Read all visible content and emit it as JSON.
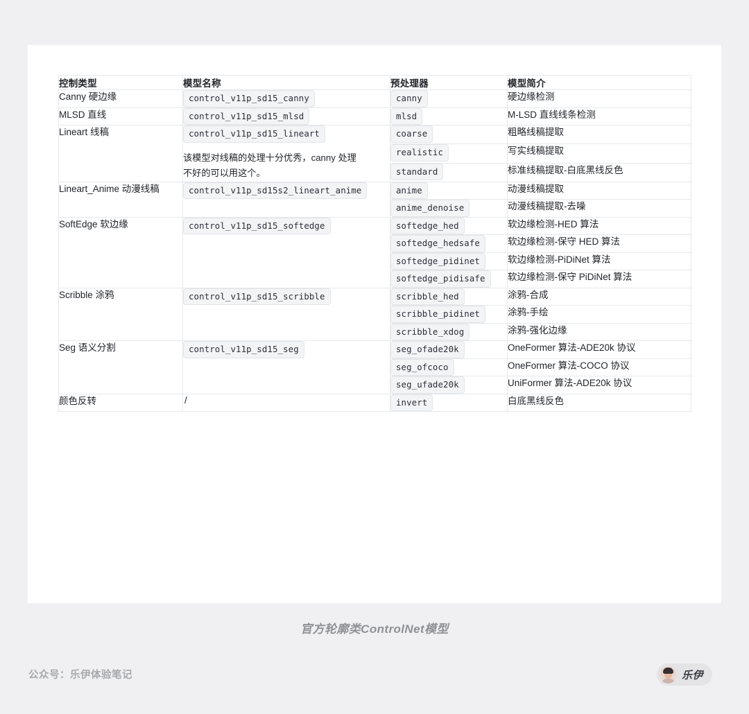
{
  "table": {
    "headers": [
      "控制类型",
      "模型名称",
      "预处理器",
      "模型简介"
    ],
    "groups": [
      {
        "type": "Canny 硬边缘",
        "model": "control_v11p_sd15_canny",
        "note": "",
        "rows": [
          {
            "preprocessor": "canny",
            "desc": "硬边缘检测"
          }
        ]
      },
      {
        "type": "MLSD 直线",
        "model": "control_v11p_sd15_mlsd",
        "note": "",
        "rows": [
          {
            "preprocessor": "mlsd",
            "desc": "M-LSD 直线线条检测"
          }
        ]
      },
      {
        "type": "Lineart 线稿",
        "model": "control_v11p_sd15_lineart",
        "note": "该模型对线稿的处理十分优秀，canny 处理不好的可以用这个。",
        "rows": [
          {
            "preprocessor": "coarse",
            "desc": "粗略线稿提取"
          },
          {
            "preprocessor": "realistic",
            "desc": "写实线稿提取"
          },
          {
            "preprocessor": "standard",
            "desc": "标准线稿提取-白底黑线反色"
          }
        ]
      },
      {
        "type": "Lineart_Anime 动漫线稿",
        "model": "control_v11p_sd15s2_lineart_anime",
        "note": "",
        "rows": [
          {
            "preprocessor": "anime",
            "desc": "动漫线稿提取"
          },
          {
            "preprocessor": "anime_denoise",
            "desc": "动漫线稿提取-去噪"
          }
        ]
      },
      {
        "type": "SoftEdge 软边缘",
        "model": "control_v11p_sd15_softedge",
        "note": "",
        "rows": [
          {
            "preprocessor": "softedge_hed",
            "desc": "软边缘检测-HED 算法"
          },
          {
            "preprocessor": "softedge_hedsafe",
            "desc": "软边缘检测-保守 HED 算法"
          },
          {
            "preprocessor": "softedge_pidinet",
            "desc": "软边缘检测-PiDiNet 算法"
          },
          {
            "preprocessor": "softedge_pidisafe",
            "desc": "软边缘检测-保守 PiDiNet 算法"
          }
        ]
      },
      {
        "type": "Scribble 涂鸦",
        "model": "control_v11p_sd15_scribble",
        "note": "",
        "rows": [
          {
            "preprocessor": "scribble_hed",
            "desc": "涂鸦-合成"
          },
          {
            "preprocessor": "scribble_pidinet",
            "desc": "涂鸦-手绘"
          },
          {
            "preprocessor": "scribble_xdog",
            "desc": "涂鸦-强化边缘"
          }
        ]
      },
      {
        "type": "Seg 语义分割",
        "model": "control_v11p_sd15_seg",
        "note": "",
        "rows": [
          {
            "preprocessor": "seg_ofade20k",
            "desc": "OneFormer 算法-ADE20k 协议"
          },
          {
            "preprocessor": "seg_ofcoco",
            "desc": "OneFormer 算法-COCO 协议"
          },
          {
            "preprocessor": "seg_ufade20k",
            "desc": "UniFormer 算法-ADE20k 协议"
          }
        ]
      },
      {
        "type": "颜色反转",
        "model": "/",
        "model_is_plain": true,
        "note": "",
        "rows": [
          {
            "preprocessor": "invert",
            "desc": "白底黑线反色"
          }
        ]
      }
    ]
  },
  "caption": "官方轮廓类ControlNet模型",
  "footer": {
    "note": "公众号：乐伊体验笔记",
    "badge_name": "乐伊"
  }
}
